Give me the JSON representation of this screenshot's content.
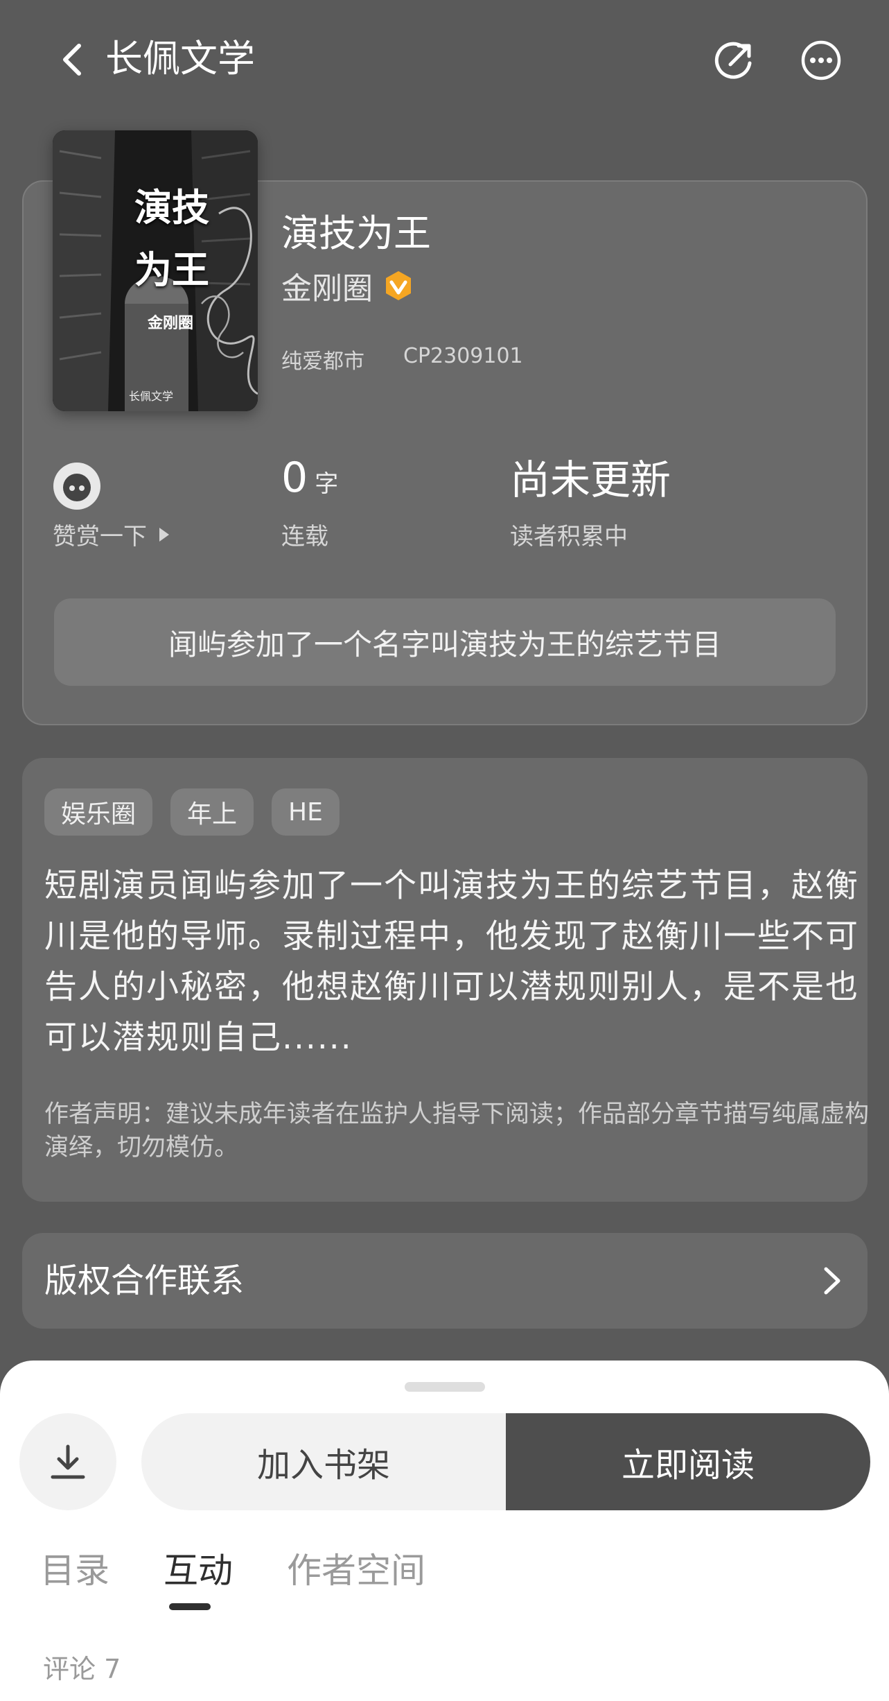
{
  "header": {
    "app_title": "长佩文学",
    "icons": {
      "back": "chevron-left-icon",
      "share": "share-icon",
      "more": "more-dots-icon"
    }
  },
  "book": {
    "cover": {
      "title_line1": "演技",
      "title_line2": "为王",
      "author": "金刚圈",
      "brand": "长佩文学"
    },
    "title": "演技为王",
    "author": "金刚圈",
    "author_badge": "verified-badge-icon",
    "category": "纯爱都市",
    "id": "CP2309101"
  },
  "stats": {
    "reward_label": "赞赏一下",
    "word_count": "0",
    "word_unit": "字",
    "serial_status": "连载",
    "update_status": "尚未更新",
    "reader_status": "读者积累中"
  },
  "tagline": "闻屿参加了一个名字叫演技为王的综艺节目",
  "synopsis": {
    "tags": [
      "娱乐圈",
      "年上",
      "HE"
    ],
    "text": "短剧演员闻屿参加了一个叫演技为王的综艺节目，赵衡川是他的导师。录制过程中，他发现了赵衡川一些不可告人的小秘密，他想赵衡川可以潜规则别人，是不是也可以潜规则自己......",
    "disclaimer": "作者声明：建议未成年读者在监护人指导下阅读；作品部分章节描写纯属虚构演绎，切勿模仿。"
  },
  "copyright": {
    "label": "版权合作联系"
  },
  "bottom_sheet": {
    "add_to_shelf": "加入书架",
    "read_now": "立即阅读",
    "tabs": [
      {
        "label": "目录",
        "active": false
      },
      {
        "label": "互动",
        "active": true
      },
      {
        "label": "作者空间",
        "active": false
      }
    ],
    "comments": "评论 7"
  },
  "colors": {
    "background": "#5a5a5a",
    "card": "#6a6a6a",
    "verified_orange": "#f5a623",
    "read_button": "#4e4e4e",
    "sheet": "#ffffff"
  }
}
